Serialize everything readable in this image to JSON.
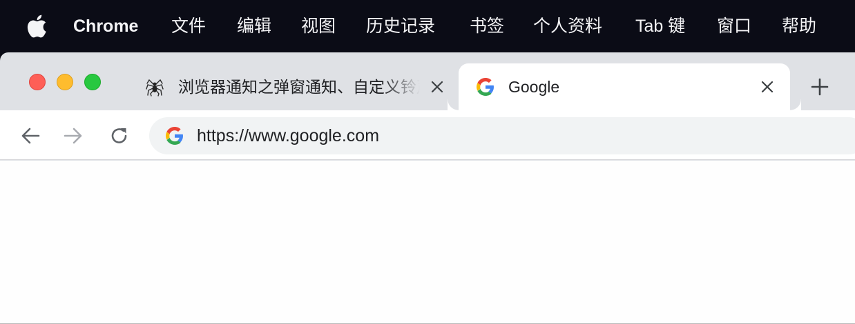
{
  "menubar": {
    "app_name": "Chrome",
    "items": [
      "文件",
      "编辑",
      "视图",
      "历史记录",
      "书签",
      "个人资料",
      "Tab 键",
      "窗口",
      "帮助"
    ]
  },
  "tabs": [
    {
      "title": "浏览器通知之弹窗通知、自定义铃声",
      "favicon": "spider-icon",
      "active": false
    },
    {
      "title": "Google",
      "favicon": "google-g-icon",
      "active": true
    }
  ],
  "toolbar": {
    "url": "https://www.google.com"
  },
  "colors": {
    "menubar_bg": "#0b0c16",
    "tabstrip_bg": "#dfe1e5",
    "omnibox_bg": "#f1f3f4",
    "close": "#fe5f57",
    "minimize": "#febc2e",
    "zoom": "#28c840"
  }
}
